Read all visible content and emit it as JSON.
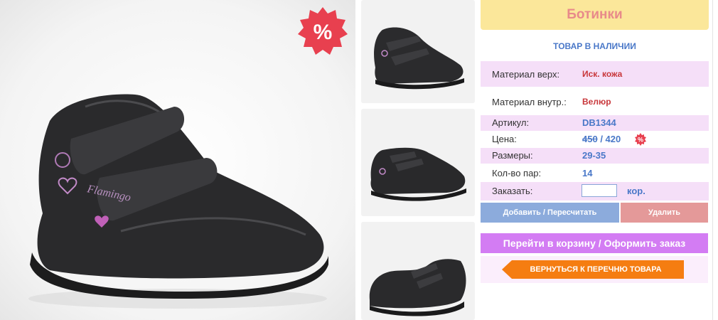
{
  "product": {
    "title": "Ботинки",
    "stock_status": "ТОВАР В НАЛИЧИИ",
    "sale_badge": "%",
    "brand_mark": "Flamingo"
  },
  "specs": {
    "material_top_label": "Материал верх:",
    "material_top_value": "Иск. кожа",
    "material_inner_label": "Материал внутр.:",
    "material_inner_value": "Велюр",
    "article_label": "Артикул:",
    "article_value": "DB1344",
    "price_label": "Цена:",
    "price_old": "450",
    "price_sep": " / ",
    "price_new": "420",
    "sizes_label": "Размеры:",
    "sizes_value": "29-35",
    "pairs_label": "Кол-во пар:",
    "pairs_value": "14",
    "order_label": "Заказать:",
    "order_value": "",
    "order_unit": "кор."
  },
  "actions": {
    "add_label": "Добавить / Пересчитать",
    "delete_label": "Удалить",
    "cart_label": "Перейти в корзину / Оформить заказ",
    "back_label": "ВЕРНУТЬСЯ К ПЕРЕЧНЮ ТОВАРА"
  },
  "colors": {
    "title_bg": "#fbe79a",
    "title_text": "#e88a8a",
    "row_pink": "#f5dff8",
    "link_blue": "#4a78c8",
    "value_red": "#c8373b",
    "add_button": "#8cabdc",
    "delete_button": "#e49999",
    "cart_button": "#d37cf3",
    "back_button": "#f57d11",
    "sale_badge": "#e8404f"
  },
  "icons": {
    "sale": "percent-burst-icon",
    "back": "arrow-left-icon"
  }
}
